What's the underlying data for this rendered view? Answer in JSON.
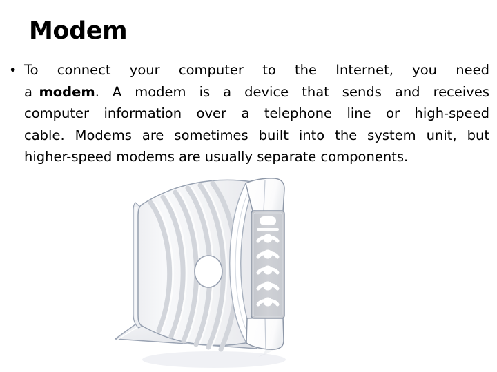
{
  "slide": {
    "title": "Modem",
    "background_color": "#ffffff",
    "text_color": "#000000"
  },
  "bullet": {
    "marker": "•",
    "lines": [
      {
        "id": "line1",
        "text": "To  connect  your  computer  to  the  Internet,  you  need",
        "justified": true
      },
      {
        "id": "line2",
        "pre": "a ",
        "bold": "modem",
        "post": ".  A  modem  is  a  device  that  sends  and  receives",
        "justified": true
      },
      {
        "id": "line3",
        "text": "computer  information  over  a  telephone  line  or  high-speed",
        "justified": true
      },
      {
        "id": "line4",
        "text": "cable. Modems are sometimes built into the system unit, but",
        "justified": true
      },
      {
        "id": "line5",
        "text": "higher-speed modems are usually separate components.",
        "justified": false
      }
    ],
    "full_text": "To connect your computer to the Internet, you need a modem. A modem is a device that sends and receives computer information over a telephone line or high-speed cable. Modems are sometimes built into the system unit, but higher-speed modems are usually separate components.",
    "emphasis_word": "modem"
  },
  "illustration": {
    "name": "cable-modem",
    "alt": "Vertical white cable modem standing on a flat base, with curved ventilation ribs, a round button and a column of indicator lights",
    "colors": {
      "body_light": "#f4f5f7",
      "body_mid": "#e6e7ea",
      "rib": "#d4d6da",
      "panel_gray": "#cbcdd2",
      "outline": "#8a94a6",
      "outline_soft": "#b9c0cc",
      "white": "#ffffff",
      "shadow": "#dfe2e8"
    },
    "led_panel": {
      "indicator_count": 6,
      "indicator_type": "dot-with-signal-arc",
      "top_indicator_type": "rounded-bar"
    },
    "button": {
      "shape": "oval",
      "fill": "#ffffff",
      "stroke": "#9aa3b2"
    }
  }
}
